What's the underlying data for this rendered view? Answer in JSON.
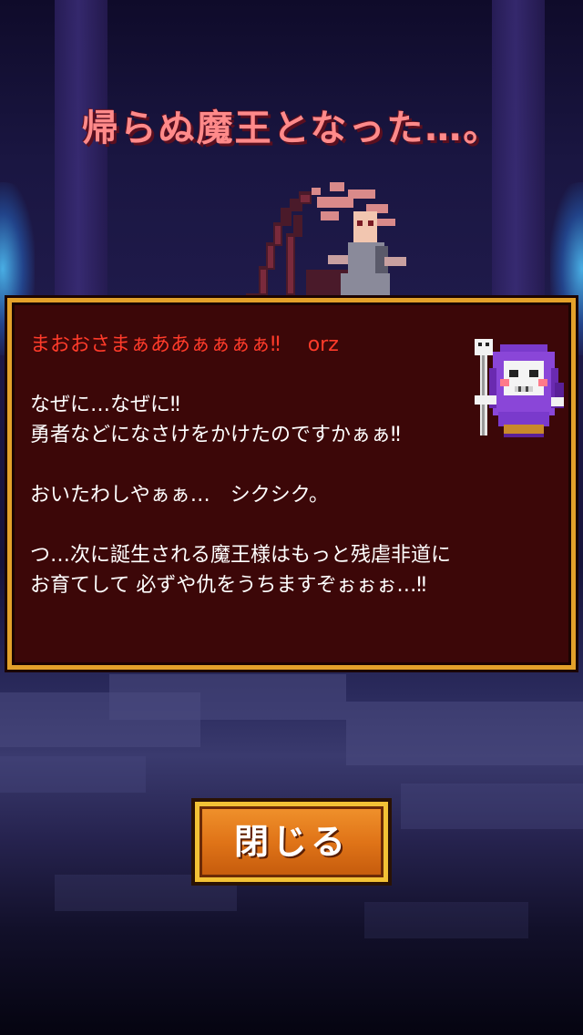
{
  "title": "帰らぬ魔王となった…。",
  "dialog": {
    "shout": "まおおさまぁああぁぁぁぁ‼",
    "orz": "orz",
    "lines": [
      "なぜに…なぜに‼",
      "勇者などになさけをかけたのですかぁぁ‼",
      "おいたわしやぁぁ…　シクシク。",
      "つ…次に誕生される魔王様はもっと残虐非道に",
      "お育てして 必ずや仇をうちますぞぉぉぉ…‼"
    ]
  },
  "close_button": {
    "label": "閉じる"
  },
  "colors": {
    "title": "#ff8a8a",
    "shout": "#ff3b2a",
    "dialog_bg": "#3c0708",
    "dialog_border": "#e3a12a",
    "button": "#e07418",
    "button_border": "#f2c236"
  }
}
